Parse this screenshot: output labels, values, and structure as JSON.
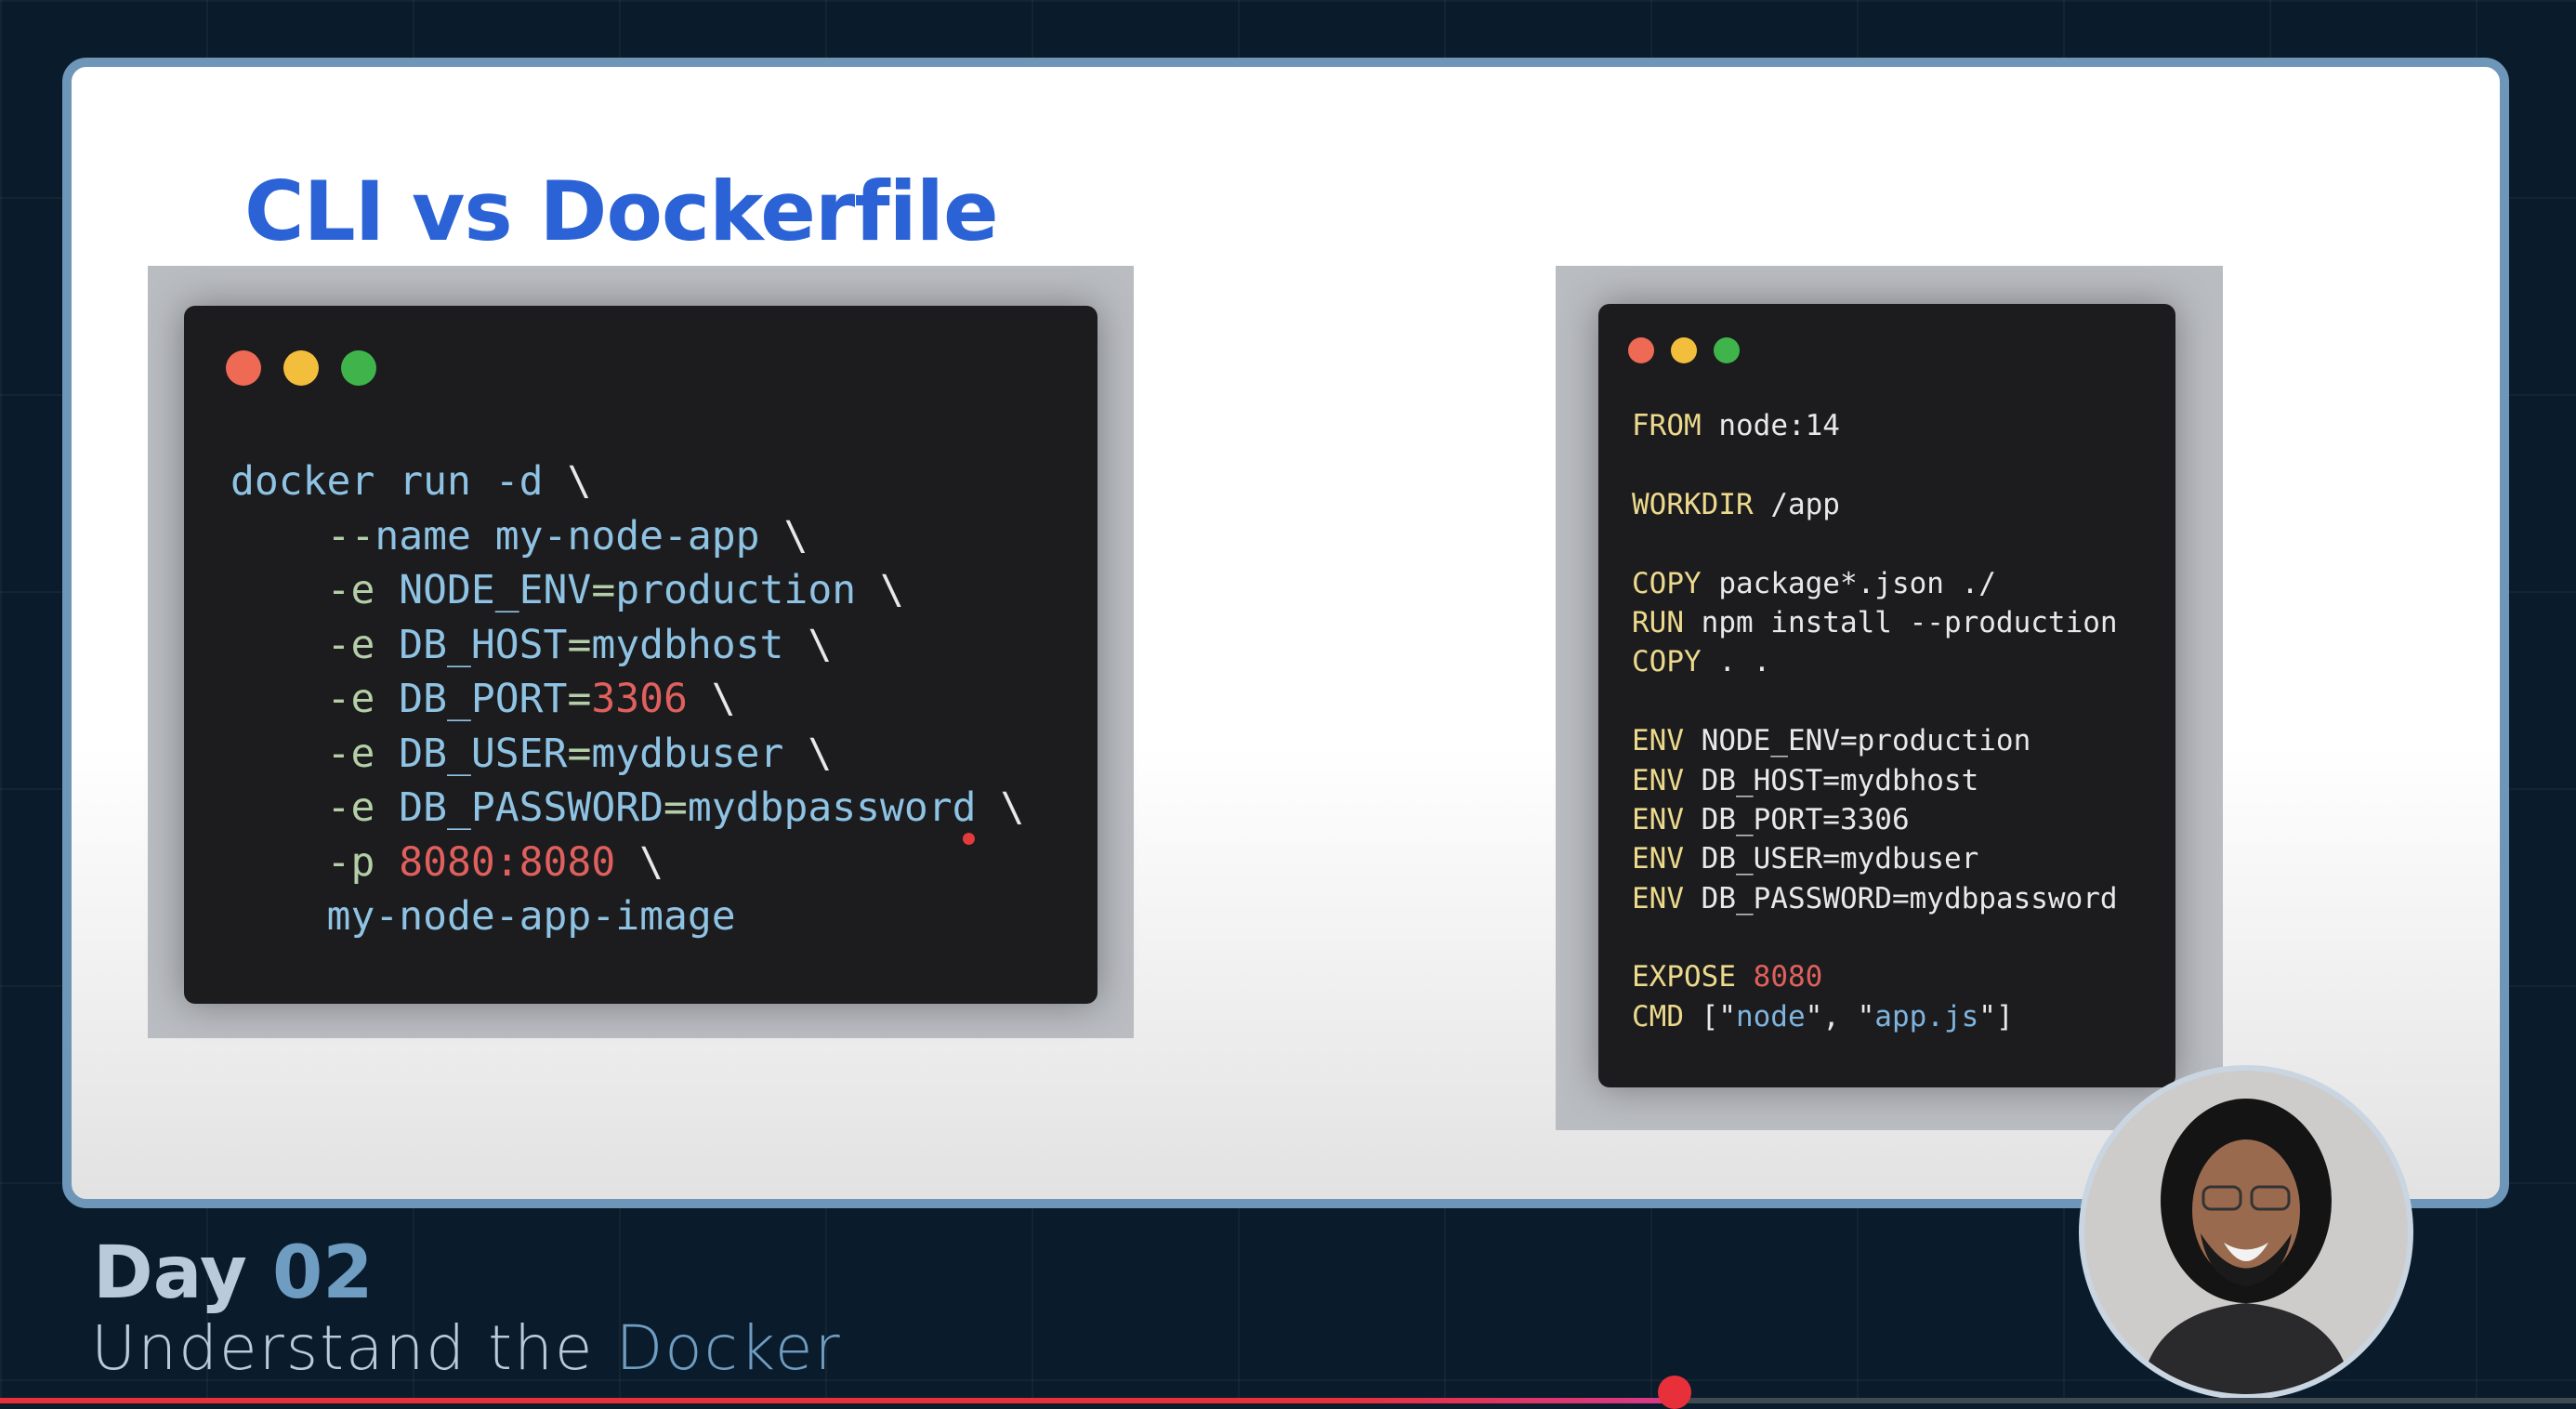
{
  "slide": {
    "title": "CLI vs Dockerfile"
  },
  "colors": {
    "accent": "#2b63d6",
    "red_dot": "#ee6a55",
    "yellow_dot": "#f3be3c",
    "green_dot": "#3fb44a"
  },
  "cli": {
    "lines": [
      [
        [
          "cmd",
          "docker run -d "
        ],
        [
          "bs",
          "\\"
        ]
      ],
      [
        [
          "flag",
          "    --"
        ],
        [
          "cmd",
          "name my-node-app "
        ],
        [
          "bs",
          "\\"
        ]
      ],
      [
        [
          "flag",
          "    -e "
        ],
        [
          "val",
          "NODE_ENV"
        ],
        [
          "flag",
          "="
        ],
        [
          "val",
          "production "
        ],
        [
          "bs",
          "\\"
        ]
      ],
      [
        [
          "flag",
          "    -e "
        ],
        [
          "val",
          "DB_HOST"
        ],
        [
          "flag",
          "="
        ],
        [
          "val",
          "mydbhost "
        ],
        [
          "bs",
          "\\"
        ]
      ],
      [
        [
          "flag",
          "    -e "
        ],
        [
          "val",
          "DB_PORT"
        ],
        [
          "flag",
          "="
        ],
        [
          "num",
          "3306 "
        ],
        [
          "bs",
          "\\"
        ]
      ],
      [
        [
          "flag",
          "    -e "
        ],
        [
          "val",
          "DB_USER"
        ],
        [
          "flag",
          "="
        ],
        [
          "val",
          "mydbuser "
        ],
        [
          "bs",
          "\\"
        ]
      ],
      [
        [
          "flag",
          "    -e "
        ],
        [
          "val",
          "DB_PASSWORD"
        ],
        [
          "flag",
          "="
        ],
        [
          "val",
          "mydbpassword "
        ],
        [
          "bs",
          "\\"
        ]
      ],
      [
        [
          "flag",
          "    -p "
        ],
        [
          "num",
          "8080:8080 "
        ],
        [
          "bs",
          "\\"
        ]
      ],
      [
        [
          "val",
          "    my-node-app-image"
        ]
      ]
    ]
  },
  "dockerfile": {
    "lines": [
      [
        [
          "kw",
          "FROM "
        ],
        [
          "txt",
          "node:14"
        ]
      ],
      [],
      [
        [
          "kw",
          "WORKDIR "
        ],
        [
          "txt",
          "/app"
        ]
      ],
      [],
      [
        [
          "kw",
          "COPY "
        ],
        [
          "txt",
          "package*.json ./"
        ]
      ],
      [
        [
          "kw",
          "RUN "
        ],
        [
          "txt",
          "npm install --production"
        ]
      ],
      [
        [
          "kw",
          "COPY "
        ],
        [
          "txt",
          ". ."
        ]
      ],
      [],
      [
        [
          "kw",
          "ENV "
        ],
        [
          "txt",
          "NODE_ENV=production"
        ]
      ],
      [
        [
          "kw",
          "ENV "
        ],
        [
          "txt",
          "DB_HOST=mydbhost"
        ]
      ],
      [
        [
          "kw",
          "ENV "
        ],
        [
          "txt",
          "DB_PORT=3306"
        ]
      ],
      [
        [
          "kw",
          "ENV "
        ],
        [
          "txt",
          "DB_USER=mydbuser"
        ]
      ],
      [
        [
          "kw",
          "ENV "
        ],
        [
          "txt",
          "DB_PASSWORD=mydbpassword"
        ]
      ],
      [],
      [
        [
          "kw",
          "EXPOSE "
        ],
        [
          "num",
          "8080"
        ]
      ],
      [
        [
          "kw",
          "CMD "
        ],
        [
          "txt",
          "[\""
        ],
        [
          "str",
          "node"
        ],
        [
          "txt",
          "\", \""
        ],
        [
          "str",
          "app.js"
        ],
        [
          "txt",
          "\"]"
        ]
      ]
    ]
  },
  "footer": {
    "day_label": "Day",
    "day_number": "02",
    "subtitle_prefix": "Understand the",
    "subtitle_highlight": "Docker"
  },
  "video": {
    "progress": 0.65
  }
}
